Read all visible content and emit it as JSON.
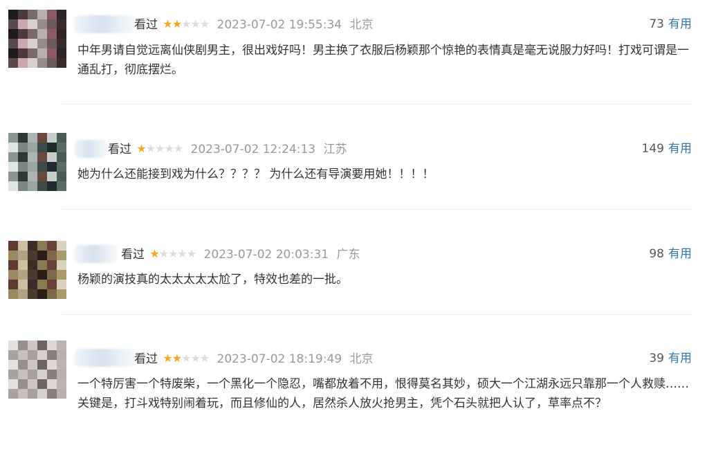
{
  "reviews": [
    {
      "status": "看过",
      "rating": 2,
      "time": "2023-07-02 19:55:34",
      "location": "北京",
      "votes": "73",
      "vote_label": "有用",
      "text": "中年男请自觉远离仙侠剧男主，很出戏好吗！男主换了衣服后杨颖那个惊艳的表情真是毫无说服力好吗！打戏可谓是一通乱打，彻底摆烂。"
    },
    {
      "status": "看过",
      "rating": 1,
      "time": "2023-07-02 12:24:13",
      "location": "江苏",
      "votes": "149",
      "vote_label": "有用",
      "text": "她为什么还能接到戏为什么？？？？ 为什么还有导演要用她！！！！"
    },
    {
      "status": "看过",
      "rating": 1,
      "time": "2023-07-02 20:03:31",
      "location": "广东",
      "votes": "98",
      "vote_label": "有用",
      "text": "杨颖的演技真的太太太太太尬了，特效也差的一批。"
    },
    {
      "status": "看过",
      "rating": 2,
      "time": "2023-07-02 18:19:49",
      "location": "北京",
      "votes": "39",
      "vote_label": "有用",
      "text": "一个特厉害一个特废柴，一个黑化一个隐忍，嘴都放着不用，恨得莫名其妙，硕大一个江湖永远只靠那一个人救赎……关键是，打斗戏特别闹着玩，而且修仙的人，居然杀人放火抢男主，凭个石头就把人认了，草率点不？"
    }
  ],
  "colors": {
    "star_on": "#f5a623",
    "star_off": "#dcdcdc",
    "useful_link": "#3377aa",
    "muted": "#999999"
  },
  "icons": {
    "star": "star-icon"
  }
}
